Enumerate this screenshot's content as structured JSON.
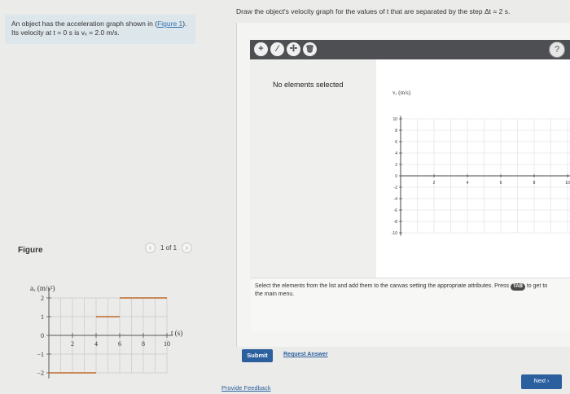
{
  "problem": {
    "line1_prefix": "An object has the acceleration graph shown in (",
    "line1_link": "Figure 1",
    "line1_suffix": ").",
    "line2": "Its velocity at t = 0 s is vₓ = 2.0 m/s."
  },
  "figure": {
    "label": "Figure",
    "pager": {
      "prev_icon": "chevron-left-icon",
      "text": "1 of 1",
      "next_icon": "chevron-right-icon"
    }
  },
  "accel_graph": {
    "ylabel": "aₓ (m/s²)",
    "xlabel": "t (s)",
    "y_ticks": [
      "2",
      "1",
      "0",
      "−1",
      "−2"
    ],
    "x_ticks": [
      "2",
      "4",
      "6",
      "8",
      "10"
    ],
    "segments": [
      {
        "t_start": 0,
        "t_end": 4,
        "a": -2
      },
      {
        "t_start": 4,
        "t_end": 6,
        "a": 1
      },
      {
        "t_start": 6,
        "t_end": 10,
        "a": 2
      }
    ],
    "colors": {
      "grid": "#c9c9c9",
      "line": "#c0692b",
      "axis": "#555555"
    }
  },
  "instruction": "Draw the object's velocity graph for the values of t that are separated by the step Δt = 2 s.",
  "toolbar": {
    "buttons": [
      {
        "icon": "plus-icon",
        "glyph": "+"
      },
      {
        "icon": "line-tool-icon",
        "glyph": "⁄"
      },
      {
        "icon": "point-tool-icon",
        "glyph": "✢"
      },
      {
        "icon": "trash-icon",
        "glyph": "🗑"
      }
    ],
    "help_glyph": "?"
  },
  "side_panel": {
    "text": "No elements selected"
  },
  "velocity_graph": {
    "ylabel": "vₓ (m/s)",
    "y_ticks": [
      "10",
      "8",
      "6",
      "4",
      "2",
      "0",
      "-2",
      "-4",
      "-6",
      "-8",
      "-10"
    ],
    "x_ticks": [
      "2",
      "4",
      "6",
      "8",
      "10"
    ],
    "xlim": [
      0,
      10
    ],
    "ylim": [
      -10,
      10
    ]
  },
  "status": {
    "text_before": "Select the elements from the list and add them to the canvas setting the appropriate attributes. Press",
    "key": "TAB",
    "text_after": "to get to the main menu."
  },
  "actions": {
    "submit": "Submit",
    "request_answer": "Request Answer",
    "provide_feedback": "Provide Feedback",
    "next": "Next ›"
  }
}
